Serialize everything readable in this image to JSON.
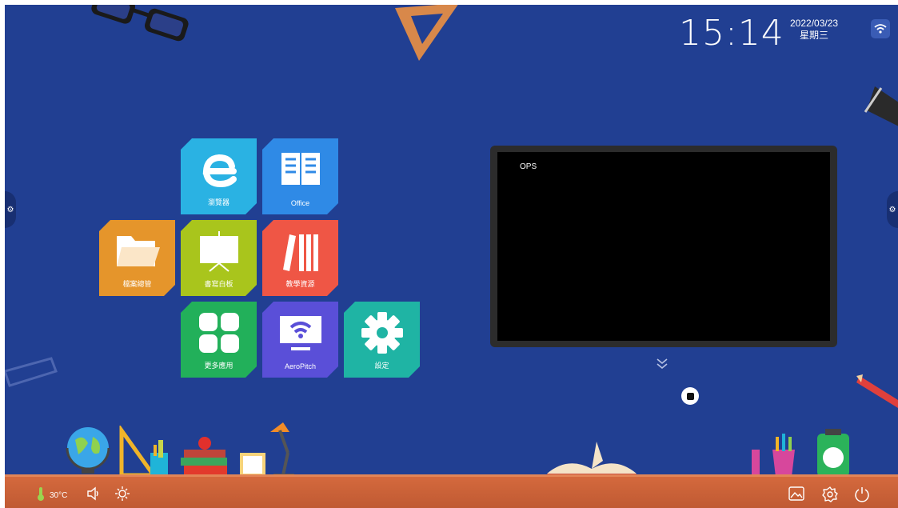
{
  "status": {
    "time": "15:14",
    "date": "2022/03/23",
    "weekday": "星期三",
    "wifi_icon": "wifi-icon"
  },
  "apps": [
    {
      "label": "瀏覽器",
      "color": "#2ab2e3",
      "icon": "browser-icon"
    },
    {
      "label": "Office",
      "color": "#2f8ae6",
      "icon": "book-icon"
    },
    {
      "label": "檔案總管",
      "color": "#e5952b",
      "icon": "folder-icon"
    },
    {
      "label": "書寫白板",
      "color": "#a9c51c",
      "icon": "whiteboard-icon"
    },
    {
      "label": "教學資源",
      "color": "#ef5645",
      "icon": "library-icon"
    },
    {
      "label": "更多應用",
      "color": "#22b05a",
      "icon": "grid-icon"
    },
    {
      "label": "AeroPitch",
      "color": "#5a4fd8",
      "icon": "cast-icon"
    },
    {
      "label": "設定",
      "color": "#1fb4a4",
      "icon": "gear-icon"
    }
  ],
  "ops": {
    "label": "OPS"
  },
  "bottom_bar": {
    "temperature": "30°C",
    "left_icons": [
      "thermometer-icon",
      "volume-icon",
      "brightness-icon"
    ],
    "right_icons": [
      "gallery-icon",
      "settings-icon",
      "power-icon"
    ]
  }
}
